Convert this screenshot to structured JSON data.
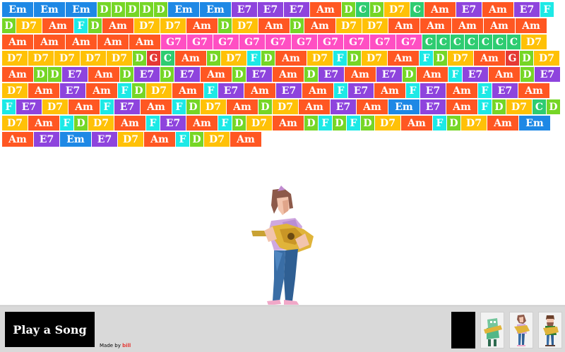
{
  "colors": {
    "Em": "#1e88e5",
    "D": "#76d626",
    "E7": "#8e44dd",
    "Am": "#ff5722",
    "C": "#2ecc71",
    "D7": "#ffc107",
    "F": "#1de9e6",
    "G7": "#ff4fc3",
    "G": "#e53935"
  },
  "chords": [
    "Em",
    "Em",
    "Em",
    "D",
    "D",
    "D",
    "D",
    "D",
    "Em",
    "Em",
    "E7",
    "E7",
    "E7",
    "Am",
    "D",
    "C",
    "D",
    "D7",
    "C",
    "Am",
    "E7",
    "Am",
    "E7",
    "F",
    "D",
    "D7",
    "Am",
    "F",
    "D",
    "Am",
    "D7",
    "D7",
    "Am",
    "D",
    "D7",
    "Am",
    "D",
    "Am",
    "D7",
    "D7",
    "Am",
    "Am",
    "Am",
    "Am",
    "Am",
    "Am",
    "Am",
    "Am",
    "Am",
    "Am",
    "G7",
    "G7",
    "G7",
    "G7",
    "G7",
    "G7",
    "G7",
    "G7",
    "G7",
    "G7",
    "C",
    "C",
    "C",
    "C",
    "C",
    "C",
    "C",
    "D7",
    "D7",
    "D7",
    "D7",
    "D7",
    "D7",
    "D",
    "G",
    "C",
    "Am",
    "D",
    "D7",
    "F",
    "D",
    "Am",
    "D7",
    "F",
    "D",
    "D7",
    "Am",
    "F",
    "D",
    "D7",
    "Am",
    "G",
    "D",
    "D7",
    "Am",
    "D",
    "D",
    "E7",
    "Am",
    "D",
    "E7",
    "D",
    "E7",
    "Am",
    "D",
    "E7",
    "Am",
    "D",
    "E7",
    "Am",
    "E7",
    "D",
    "Am",
    "F",
    "E7",
    "Am",
    "D",
    "E7",
    "D7",
    "Am",
    "E7",
    "Am",
    "F",
    "D",
    "D7",
    "Am",
    "F",
    "E7",
    "Am",
    "E7",
    "Am",
    "F",
    "E7",
    "Am",
    "F",
    "E7",
    "Am",
    "F",
    "E7",
    "Am",
    "F",
    "E7",
    "D7",
    "Am",
    "F",
    "E7",
    "Am",
    "F",
    "D",
    "D7",
    "Am",
    "D",
    "D7",
    "Am",
    "E7",
    "Am",
    "Em",
    "E7",
    "Am",
    "F",
    "D",
    "D7",
    "C",
    "D",
    "D7",
    "Am",
    "F",
    "D",
    "D7",
    "Am",
    "F",
    "E7",
    "Am",
    "F",
    "D",
    "D7",
    "Am",
    "D",
    "F",
    "D",
    "F",
    "D",
    "D7",
    "Am",
    "F",
    "D",
    "D7",
    "Am",
    "Em",
    "Am",
    "E7",
    "Em",
    "E7",
    "D7",
    "Am",
    "F",
    "D",
    "D7",
    "Am"
  ],
  "play_button": {
    "label": "Play a Song"
  },
  "credit": {
    "prefix": "Made by",
    "author": "bill"
  },
  "thumbnails": [
    "blank-player",
    "robot-player",
    "girl-player",
    "man-player"
  ]
}
